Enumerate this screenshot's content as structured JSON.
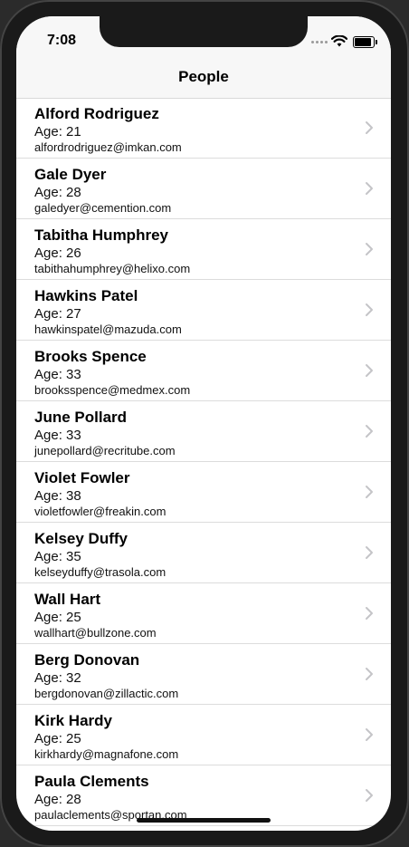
{
  "status": {
    "time": "7:08"
  },
  "nav": {
    "title": "People"
  },
  "people": [
    {
      "name": "Alford Rodriguez",
      "age": "Age: 21",
      "email": "alfordrodriguez@imkan.com"
    },
    {
      "name": "Gale Dyer",
      "age": "Age: 28",
      "email": "galedyer@cemention.com"
    },
    {
      "name": "Tabitha Humphrey",
      "age": "Age: 26",
      "email": "tabithahumphrey@helixo.com"
    },
    {
      "name": "Hawkins Patel",
      "age": "Age: 27",
      "email": "hawkinspatel@mazuda.com"
    },
    {
      "name": "Brooks Spence",
      "age": "Age: 33",
      "email": "brooksspence@medmex.com"
    },
    {
      "name": "June Pollard",
      "age": "Age: 33",
      "email": "junepollard@recritube.com"
    },
    {
      "name": "Violet Fowler",
      "age": "Age: 38",
      "email": "violetfowler@freakin.com"
    },
    {
      "name": "Kelsey Duffy",
      "age": "Age: 35",
      "email": "kelseyduffy@trasola.com"
    },
    {
      "name": "Wall Hart",
      "age": "Age: 25",
      "email": "wallhart@bullzone.com"
    },
    {
      "name": "Berg Donovan",
      "age": "Age: 32",
      "email": "bergdonovan@zillactic.com"
    },
    {
      "name": "Kirk Hardy",
      "age": "Age: 25",
      "email": "kirkhardy@magnafone.com"
    },
    {
      "name": "Paula Clements",
      "age": "Age: 28",
      "email": "paulaclements@sportan.com"
    }
  ]
}
